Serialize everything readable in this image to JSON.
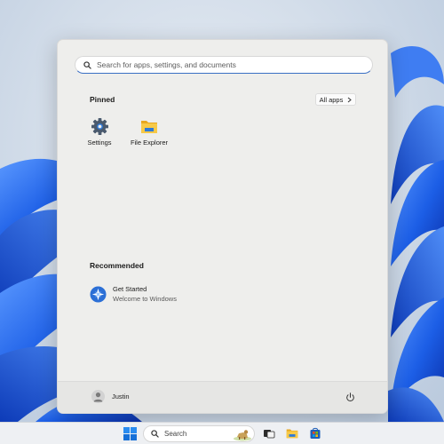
{
  "start_menu": {
    "search": {
      "placeholder": "Search for apps, settings, and documents",
      "icon": "search-icon"
    },
    "pinned": {
      "title": "Pinned",
      "all_apps_label": "All apps",
      "all_apps_icon": "chevron-right-icon",
      "apps": [
        {
          "label": "Settings",
          "icon": "gear-icon"
        },
        {
          "label": "File Explorer",
          "icon": "folder-icon"
        }
      ]
    },
    "recommended": {
      "title": "Recommended",
      "items": [
        {
          "title": "Get Started",
          "subtitle": "Welcome to Windows",
          "icon": "get-started-icon"
        }
      ]
    },
    "footer": {
      "user_name": "Justin",
      "avatar_icon": "user-icon",
      "power_icon": "power-icon"
    }
  },
  "taskbar": {
    "start_icon": "windows-logo-icon",
    "search_label": "Search",
    "search_icon": "search-icon",
    "search_highlight_icon": "search-highlight-icon",
    "apps": [
      {
        "name": "Task View",
        "icon": "task-view-icon"
      },
      {
        "name": "File Explorer",
        "icon": "folder-icon"
      },
      {
        "name": "Microsoft Store",
        "icon": "store-icon"
      }
    ]
  },
  "colors": {
    "accent": "#3a6fc4",
    "wallpaper_bloom": "#1f5fe0",
    "menu_background": "#eeeeec"
  }
}
